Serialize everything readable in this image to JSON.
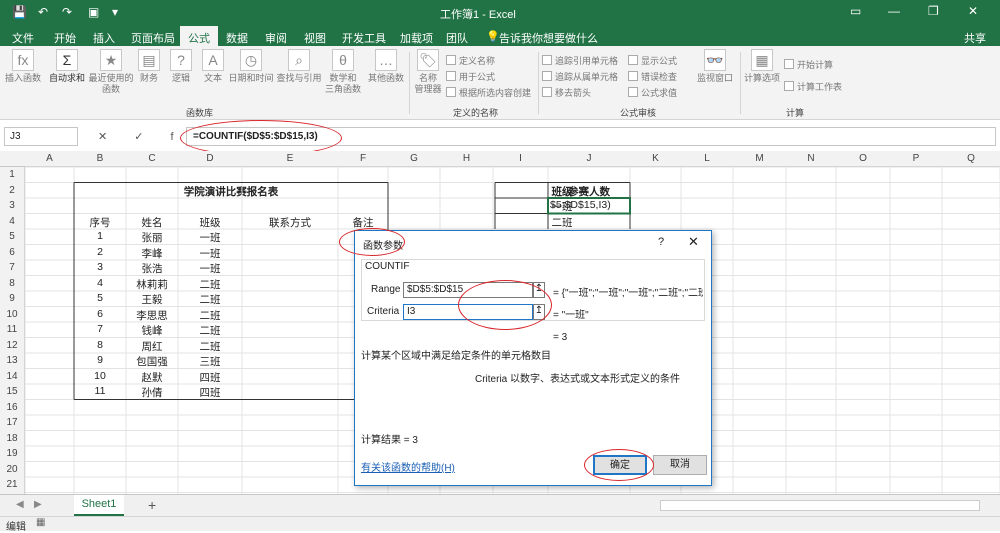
{
  "window": {
    "title": "工作簿1 - Excel",
    "controls": [
      "▭",
      "—",
      "❐",
      "✕"
    ]
  },
  "quick_access": [
    "💾",
    "↶",
    "↷",
    "▣",
    "▾"
  ],
  "menu": {
    "items": [
      "文件",
      "开始",
      "插入",
      "页面布局",
      "公式",
      "数据",
      "审阅",
      "视图",
      "开发工具",
      "加载项",
      "团队"
    ],
    "active": "公式",
    "tell_me": "告诉我你想要做什么",
    "share": "共享"
  },
  "ribbon": {
    "library": [
      "插入函数",
      "自动求和",
      "最近使用的\n函数",
      "财务",
      "逻辑",
      "文本",
      "日期和时间",
      "查找与引用",
      "数学和\n三角函数",
      "其他函数"
    ],
    "library_group": "函数库",
    "names_manager": "名称\n管理器",
    "names_small": [
      "定义名称",
      "用于公式",
      "根据所选内容创建"
    ],
    "names_group": "定义的名称",
    "audit_small": [
      "追踪引用单元格",
      "追踪从属单元格",
      "移去箭头",
      "显示公式",
      "错误检查",
      "公式求值"
    ],
    "watch": "监视窗口",
    "audit_group": "公式审核",
    "calc_options": "计算选项",
    "calc_small": [
      "开始计算",
      "计算工作表"
    ],
    "calc_group": "计算"
  },
  "formula_bar": {
    "name_box": "J3",
    "fx_buttons": "✕ ✓ fx",
    "formula": "=COUNTIF($D$5:$D$15,I3)"
  },
  "columns": [
    "A",
    "B",
    "C",
    "D",
    "E",
    "F",
    "G",
    "H",
    "I",
    "J",
    "K",
    "L",
    "M",
    "N",
    "O",
    "P",
    "Q"
  ],
  "rows": [
    "1",
    "2",
    "3",
    "4",
    "5",
    "6",
    "7",
    "8",
    "9",
    "10",
    "11",
    "12",
    "13",
    "14",
    "15",
    "16",
    "17",
    "18",
    "19",
    "20",
    "21",
    "22",
    "23"
  ],
  "table": {
    "title": "学院演讲比赛报名表",
    "headers": [
      "序号",
      "姓名",
      "班级",
      "联系方式",
      "备注"
    ],
    "rows": [
      [
        "1",
        "张丽",
        "一班"
      ],
      [
        "2",
        "李峰",
        "一班"
      ],
      [
        "3",
        "张浩",
        "一班"
      ],
      [
        "4",
        "林莉莉",
        "二班"
      ],
      [
        "5",
        "王毅",
        "二班"
      ],
      [
        "6",
        "李思思",
        "二班"
      ],
      [
        "7",
        "钱峰",
        "二班"
      ],
      [
        "8",
        "周红",
        "二班"
      ],
      [
        "9",
        "包国强",
        "三班"
      ],
      [
        "10",
        "赵默",
        "四班"
      ],
      [
        "11",
        "孙倩",
        "四班"
      ]
    ]
  },
  "summary": {
    "headers": [
      "班级",
      "参赛人数"
    ],
    "class1": "一班",
    "editing": "$5:$D$15,I3)",
    "class2": "二班"
  },
  "dialog": {
    "title": "函数参数",
    "help_q": "?",
    "close": "✕",
    "func": "COUNTIF",
    "range_label": "Range",
    "range_value": "$D$5:$D$15",
    "range_result": "= {\"一班\";\"一班\";\"一班\";\"二班\";\"二班",
    "criteria_label": "Criteria",
    "criteria_value": "I3",
    "criteria_result": "= \"一班\"",
    "total": "= 3",
    "description": "计算某个区域中满足给定条件的单元格数目",
    "arg_desc": "Criteria  以数字、表达式或文本形式定义的条件",
    "result_label": "计算结果 =  3",
    "help_link": "有关该函数的帮助(H)",
    "ok": "确定",
    "cancel": "取消"
  },
  "sheet": {
    "tab": "Sheet1",
    "add": "+"
  },
  "status": {
    "mode": "编辑"
  }
}
